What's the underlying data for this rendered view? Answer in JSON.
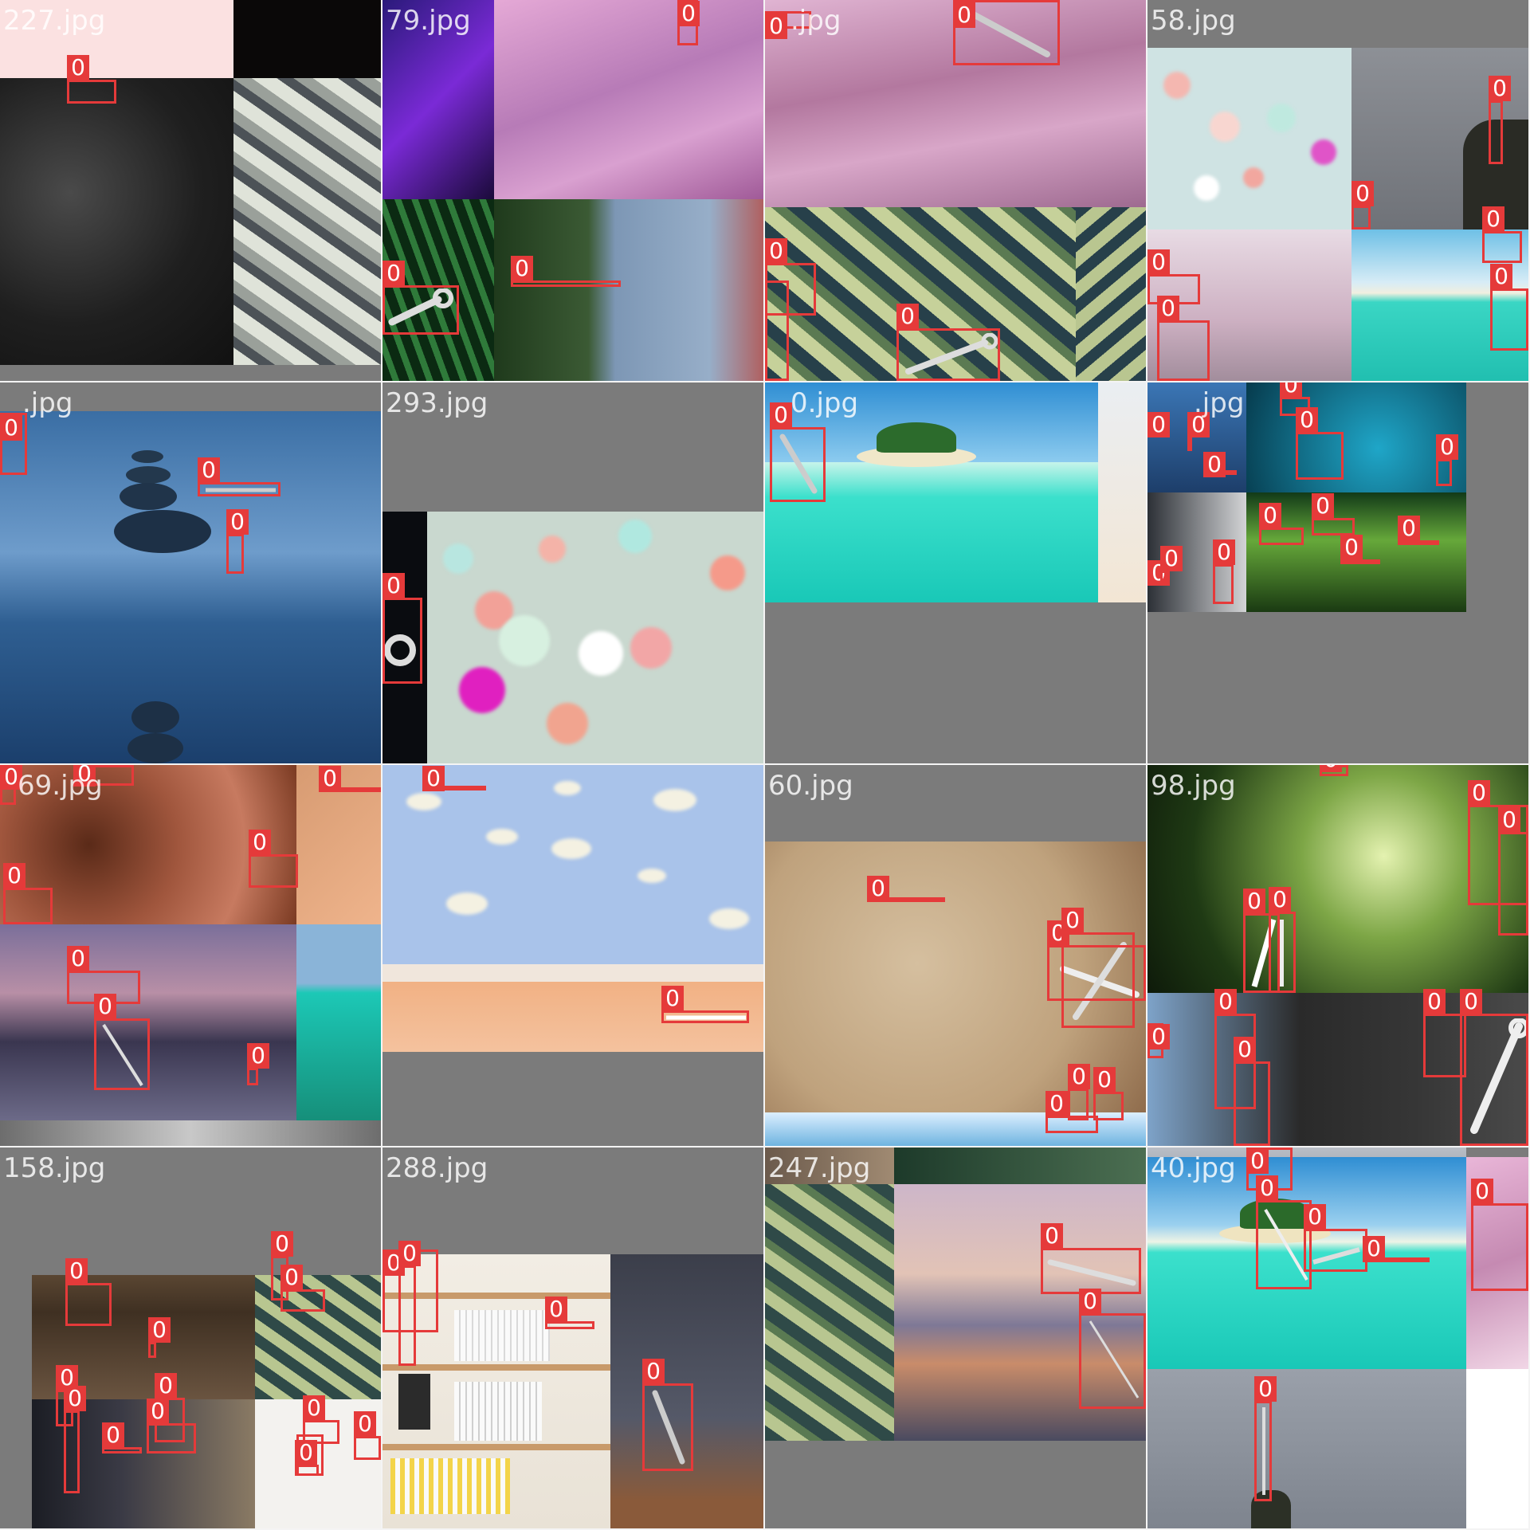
{
  "colors": {
    "box": "#e53a3a",
    "label_text": "#ffffff",
    "filename_text": "rgba(255,255,255,0.82)",
    "pad": "#7b7b7b"
  },
  "tiles": [
    {
      "name": "227.jpg",
      "label": "227.jpg"
    },
    {
      "name": "79.jpg",
      "label": "79.jpg"
    },
    {
      "name": "?.jpg",
      "label": ".jpg"
    },
    {
      "name": "58.jpg",
      "label": "58.jpg"
    },
    {
      "name": "?.jpg",
      "label": ".jpg"
    },
    {
      "name": "293.jpg",
      "label": "293.jpg"
    },
    {
      "name": "?0.jpg",
      "label": "0.jpg"
    },
    {
      "name": "?17.jpg",
      "label": ".jpg"
    },
    {
      "name": "?69.jpg",
      "label": "69.jpg"
    },
    {
      "name": "19?.jpg",
      "label": ""
    },
    {
      "name": "60.jpg",
      "label": "60.jpg"
    },
    {
      "name": "98.jpg",
      "label": "98.jpg"
    },
    {
      "name": "158.jpg",
      "label": "158.jpg"
    },
    {
      "name": "288.jpg",
      "label": "288.jpg"
    },
    {
      "name": "247.jpg",
      "label": "247.jpg"
    },
    {
      "name": "40.jpg",
      "label": "40.jpg"
    }
  ],
  "detection_class_label": "0",
  "objects": {
    "class_name": "wrench",
    "icon": "wrench-icon"
  }
}
